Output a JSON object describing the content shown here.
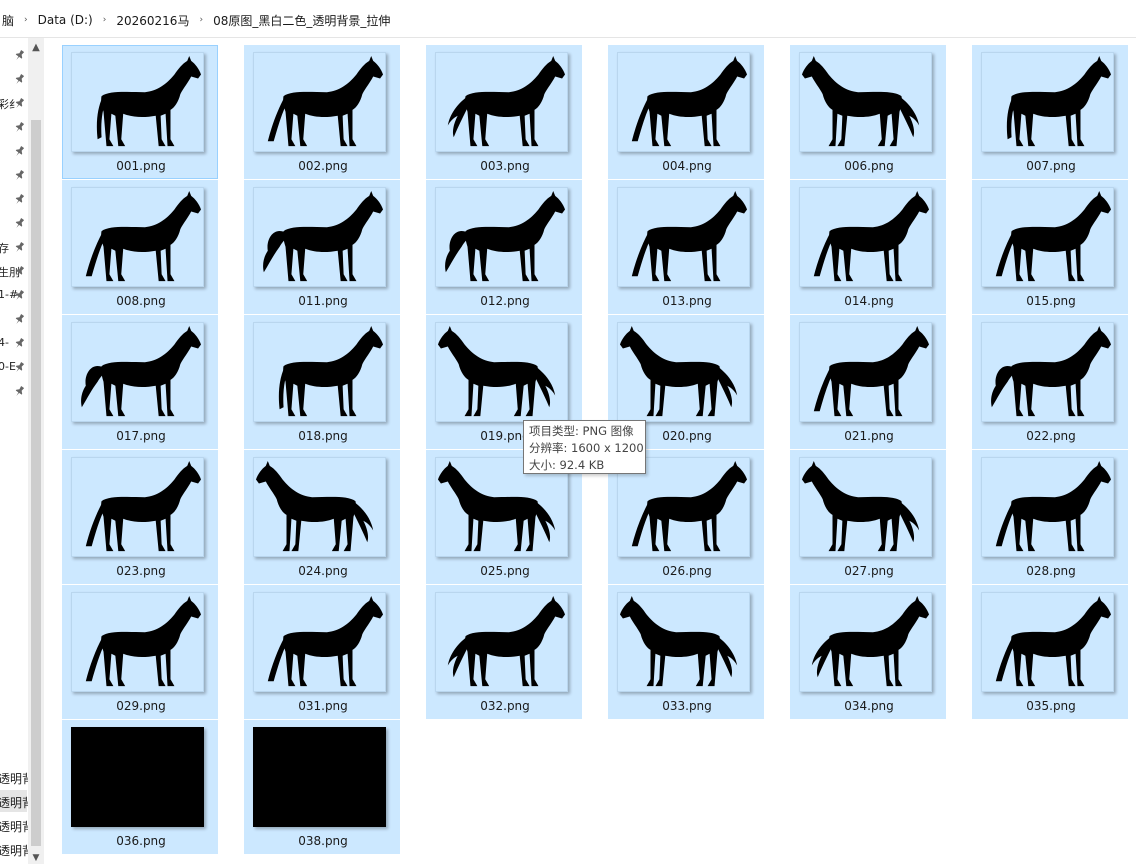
{
  "breadcrumb": [
    "脑",
    "Data (D:)",
    "20260216马",
    "08原图_黑白二色_透明背景_拉伸"
  ],
  "nav": {
    "items": [
      "",
      "",
      "彩纟",
      "",
      "",
      "",
      "",
      "",
      "存",
      "生刖",
      "1-#",
      "",
      "4-",
      "0-E",
      ""
    ],
    "bottom_items": [
      "透明背",
      "透明背",
      "透明背",
      "透明背"
    ]
  },
  "files": [
    {
      "name": "001.png",
      "kind": "horse",
      "pose": 0
    },
    {
      "name": "002.png",
      "kind": "horse",
      "pose": 1
    },
    {
      "name": "003.png",
      "kind": "horse",
      "pose": 2
    },
    {
      "name": "004.png",
      "kind": "horse",
      "pose": 1
    },
    {
      "name": "006.png",
      "kind": "horse",
      "pose": 3
    },
    {
      "name": "007.png",
      "kind": "horse",
      "pose": 0
    },
    {
      "name": "008.png",
      "kind": "horse",
      "pose": 1
    },
    {
      "name": "011.png",
      "kind": "horse",
      "pose": 4
    },
    {
      "name": "012.png",
      "kind": "horse",
      "pose": 4
    },
    {
      "name": "013.png",
      "kind": "horse",
      "pose": 1
    },
    {
      "name": "014.png",
      "kind": "horse",
      "pose": 1
    },
    {
      "name": "015.png",
      "kind": "horse",
      "pose": 1
    },
    {
      "name": "017.png",
      "kind": "horse",
      "pose": 4
    },
    {
      "name": "018.png",
      "kind": "horse",
      "pose": 0
    },
    {
      "name": "019.png",
      "kind": "horse",
      "pose": 3
    },
    {
      "name": "020.png",
      "kind": "horse",
      "pose": 3
    },
    {
      "name": "021.png",
      "kind": "horse",
      "pose": 1
    },
    {
      "name": "022.png",
      "kind": "horse",
      "pose": 4
    },
    {
      "name": "023.png",
      "kind": "horse",
      "pose": 1
    },
    {
      "name": "024.png",
      "kind": "horse",
      "pose": 3
    },
    {
      "name": "025.png",
      "kind": "horse",
      "pose": 3
    },
    {
      "name": "026.png",
      "kind": "horse",
      "pose": 1
    },
    {
      "name": "027.png",
      "kind": "horse",
      "pose": 3
    },
    {
      "name": "028.png",
      "kind": "horse",
      "pose": 1
    },
    {
      "name": "029.png",
      "kind": "horse",
      "pose": 1
    },
    {
      "name": "031.png",
      "kind": "horse",
      "pose": 1
    },
    {
      "name": "032.png",
      "kind": "horse",
      "pose": 2
    },
    {
      "name": "033.png",
      "kind": "horse",
      "pose": 3
    },
    {
      "name": "034.png",
      "kind": "horse",
      "pose": 2
    },
    {
      "name": "035.png",
      "kind": "horse",
      "pose": 1
    },
    {
      "name": "036.png",
      "kind": "black"
    },
    {
      "name": "038.png",
      "kind": "black"
    }
  ],
  "selection": {
    "focused": "001.png",
    "unselected": [],
    "hovered": "019.png"
  },
  "tooltip": {
    "type_line": "项目类型: PNG 图像",
    "resolution_line": "分辨率: 1600 x 1200",
    "size_line": "大小: 92.4 KB"
  },
  "colors": {
    "selected_bg": "#cce8ff",
    "focus_border": "#99d1ff",
    "silhouette": "#000000"
  },
  "icons": {
    "breadcrumb_separator": "chevron-right-icon",
    "pin": "pin-icon",
    "scroll_up": "scroll-up-arrow-icon",
    "scroll_down": "scroll-down-arrow-icon"
  }
}
